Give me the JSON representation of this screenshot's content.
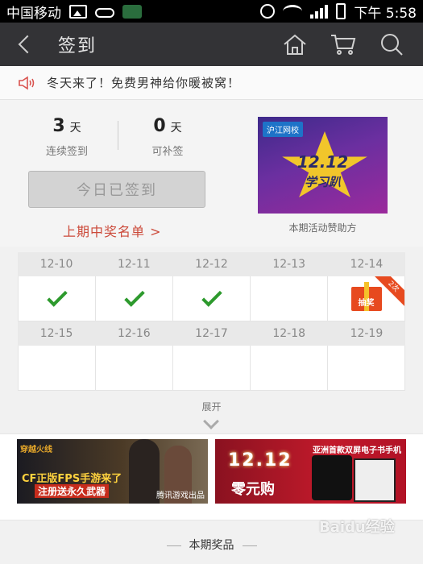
{
  "status_bar": {
    "carrier": "中国移动",
    "time": "下午 5:58"
  },
  "nav": {
    "title": "签到"
  },
  "notice": {
    "text": "冬天来了！免费男神给你暖被窝！"
  },
  "stats": {
    "consecutive": {
      "value": "3",
      "unit": "天",
      "label": "连续签到"
    },
    "makeup": {
      "value": "0",
      "unit": "天",
      "label": "可补签"
    }
  },
  "sign_button_label": "今日已签到",
  "winners_link": "上期中奖名单 >",
  "sponsor": {
    "logo": "沪江网校",
    "headline": "12.12",
    "subline": "学习趴",
    "caption": "本期活动赞助方"
  },
  "calendar": {
    "week1": [
      {
        "date": "12-10",
        "status": "checked"
      },
      {
        "date": "12-11",
        "status": "checked"
      },
      {
        "date": "12-12",
        "status": "checked"
      },
      {
        "date": "12-13",
        "status": "empty"
      },
      {
        "date": "12-14",
        "status": "gift",
        "gift_label": "抽奖",
        "ribbon": "2次"
      }
    ],
    "week2": [
      {
        "date": "12-15",
        "status": "empty"
      },
      {
        "date": "12-16",
        "status": "empty"
      },
      {
        "date": "12-17",
        "status": "empty"
      },
      {
        "date": "12-18",
        "status": "empty"
      },
      {
        "date": "12-19",
        "status": "empty"
      }
    ]
  },
  "expand_label": "展开",
  "banners": {
    "cf": {
      "title": "穿越火线",
      "line1": "CF正版FPS手游来了",
      "line2": "注册送永久武器",
      "tag": "腾讯游戏出品"
    },
    "mall": {
      "top": "亚洲首款双屏电子书手机",
      "date": "12.12",
      "zero": "零元购"
    }
  },
  "prize_title": "本期奖品",
  "watermark": "Baidu经验"
}
